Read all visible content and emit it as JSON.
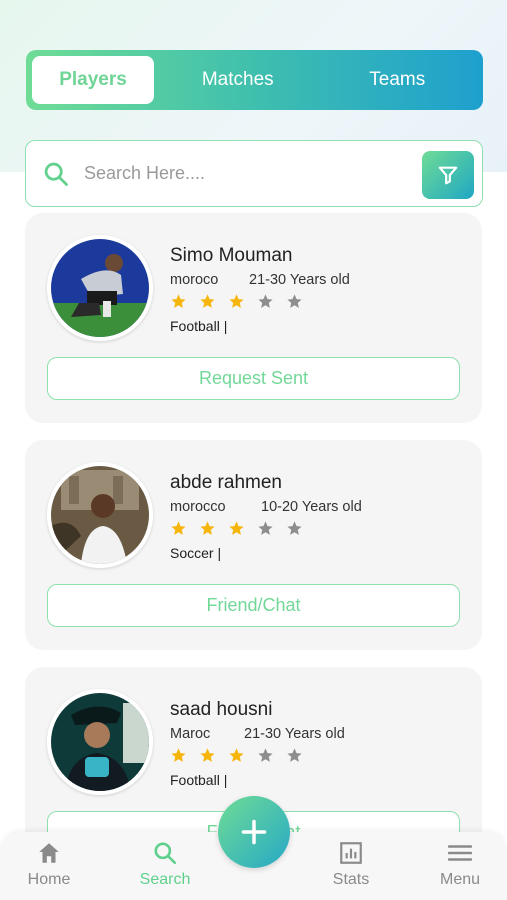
{
  "tabs": [
    {
      "label": "Players",
      "active": true
    },
    {
      "label": "Matches",
      "active": false
    },
    {
      "label": "Teams",
      "active": false
    }
  ],
  "search": {
    "placeholder": "Search Here...."
  },
  "players": [
    {
      "name": "Simo Mouman",
      "country": "moroco",
      "age": "21-30 Years old",
      "rating": 3,
      "max_rating": 5,
      "sport": "Football   |",
      "button": "Request Sent"
    },
    {
      "name": "abde rahmen",
      "country": "morocco",
      "age": "10-20 Years old",
      "rating": 3,
      "max_rating": 5,
      "sport": "Soccer   |",
      "button": "Friend/Chat"
    },
    {
      "name": "saad housni",
      "country": "Maroc",
      "age": "21-30 Years old",
      "rating": 3,
      "max_rating": 5,
      "sport": "Football   |",
      "button": "Friend/Chat"
    }
  ],
  "nav": {
    "home": "Home",
    "search": "Search",
    "stats": "Stats",
    "menu": "Menu"
  },
  "colors": {
    "accent_green": "#6fdc95",
    "accent_blue": "#1ea0cf",
    "star_filled": "#f5b50a",
    "star_empty": "#8e8e8e"
  }
}
